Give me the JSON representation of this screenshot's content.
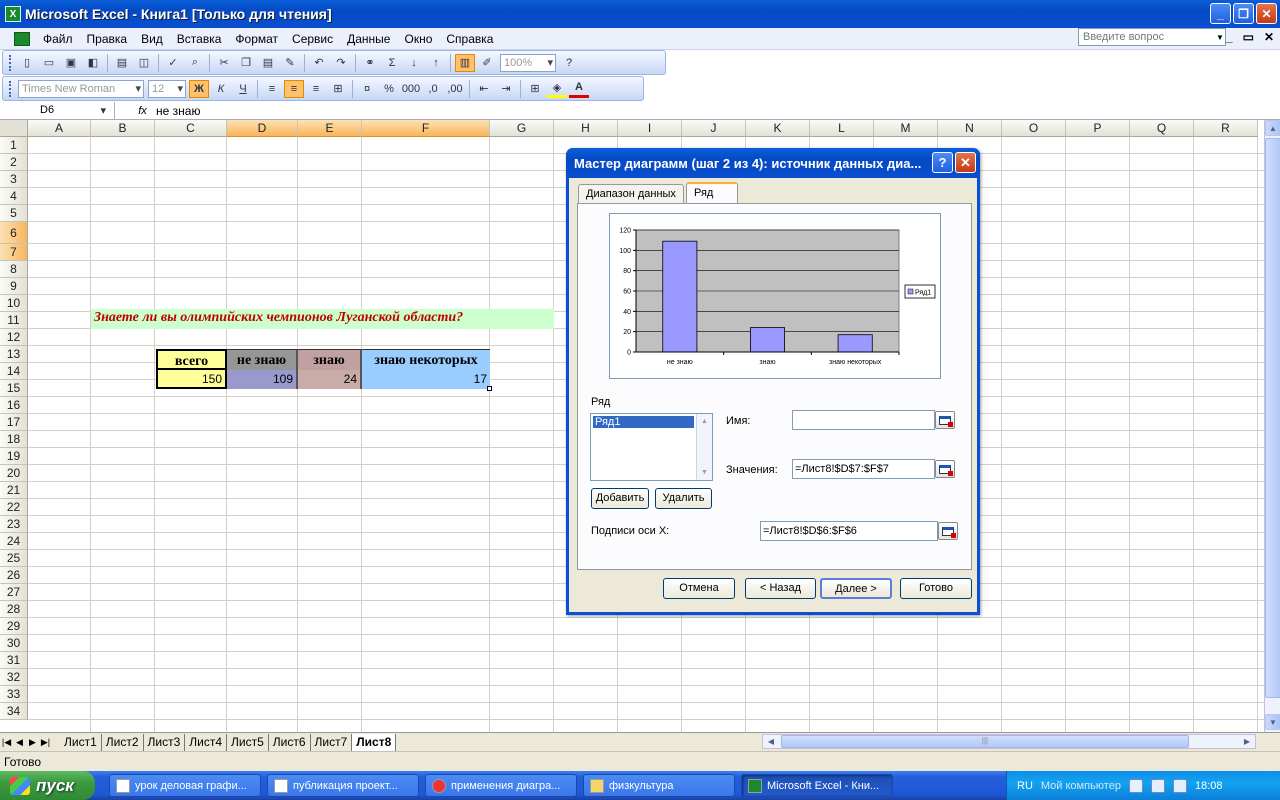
{
  "window": {
    "title": "Microsoft Excel - Книга1  [Только для чтения]"
  },
  "menu": {
    "items": [
      "Файл",
      "Правка",
      "Вид",
      "Вставка",
      "Формат",
      "Сервис",
      "Данные",
      "Окно",
      "Справка"
    ],
    "help_placeholder": "Введите вопрос"
  },
  "toolbar": {
    "zoom": "100%",
    "font_name": "Times New Roman",
    "font_size": "12"
  },
  "formula_bar": {
    "cell_ref": "D6",
    "fx": "fx",
    "value": "не знаю"
  },
  "grid": {
    "columns": [
      "A",
      "B",
      "C",
      "D",
      "E",
      "F",
      "G",
      "H",
      "I",
      "J",
      "K",
      "L",
      "M",
      "N",
      "O",
      "P",
      "Q",
      "R"
    ],
    "rows": [
      "1",
      "2",
      "3",
      "4",
      "5",
      "6",
      "7",
      "8",
      "9",
      "10",
      "11",
      "12",
      "13",
      "14",
      "15",
      "16",
      "17",
      "18",
      "19",
      "20",
      "21",
      "22",
      "23",
      "24",
      "25",
      "26",
      "27",
      "28",
      "29",
      "30",
      "31",
      "32",
      "33",
      "34"
    ]
  },
  "sheet": {
    "question": "Знаете ли вы олимпийских чемпионов Луганской области?",
    "headers": [
      "всего",
      "не знаю",
      "знаю",
      "знаю некоторых"
    ],
    "values": [
      "150",
      "109",
      "24",
      "17"
    ],
    "header_colors": [
      "#ffff99",
      "#969696",
      "#c0a0a0",
      "#99ccff"
    ],
    "value_colors": [
      "#ffff99",
      "#9999cc",
      "#c9aca8",
      "#99ccff"
    ]
  },
  "sheet_tabs": [
    "Лист1",
    "Лист2",
    "Лист3",
    "Лист4",
    "Лист5",
    "Лист6",
    "Лист7",
    "Лист8"
  ],
  "active_sheet": "Лист8",
  "status": {
    "text": "Готово"
  },
  "dialog": {
    "title": "Мастер диаграмм (шаг 2 из 4): источник данных диа...",
    "tabs": [
      "Диапазон данных",
      "Ряд"
    ],
    "active_tab": "Ряд",
    "series_group_label": "Ряд",
    "series_list": [
      "Ряд1"
    ],
    "name_label": "Имя:",
    "name_value": "",
    "values_label": "Значения:",
    "values_value": "=Лист8!$D$7:$F$7",
    "add_button": "Добавить",
    "remove_button": "Удалить",
    "xlabels_label": "Подписи оси X:",
    "xlabels_value": "=Лист8!$D$6:$F$6",
    "buttons": {
      "cancel": "Отмена",
      "back": "< Назад",
      "next": "Далее >",
      "finish": "Готово"
    }
  },
  "chart_data": {
    "type": "bar",
    "categories": [
      "не знаю",
      "знаю",
      "знаю некоторых"
    ],
    "series": [
      {
        "name": "Ряд1",
        "values": [
          109,
          24,
          17
        ],
        "color": "#9999ff"
      }
    ],
    "ylim": [
      0,
      120
    ],
    "yticks": [
      0,
      20,
      40,
      60,
      80,
      100,
      120
    ],
    "plot_background": "#c0c0c0",
    "grid": true,
    "legend": "right"
  },
  "taskbar": {
    "start": "пуск",
    "tasks": [
      "урок деловая графи...",
      "публикация проект...",
      "применения диагра...",
      "физкультура",
      "Microsoft Excel - Кни..."
    ],
    "lang": "RU",
    "tray_label": "Мой компьютер",
    "clock": "18:08"
  }
}
